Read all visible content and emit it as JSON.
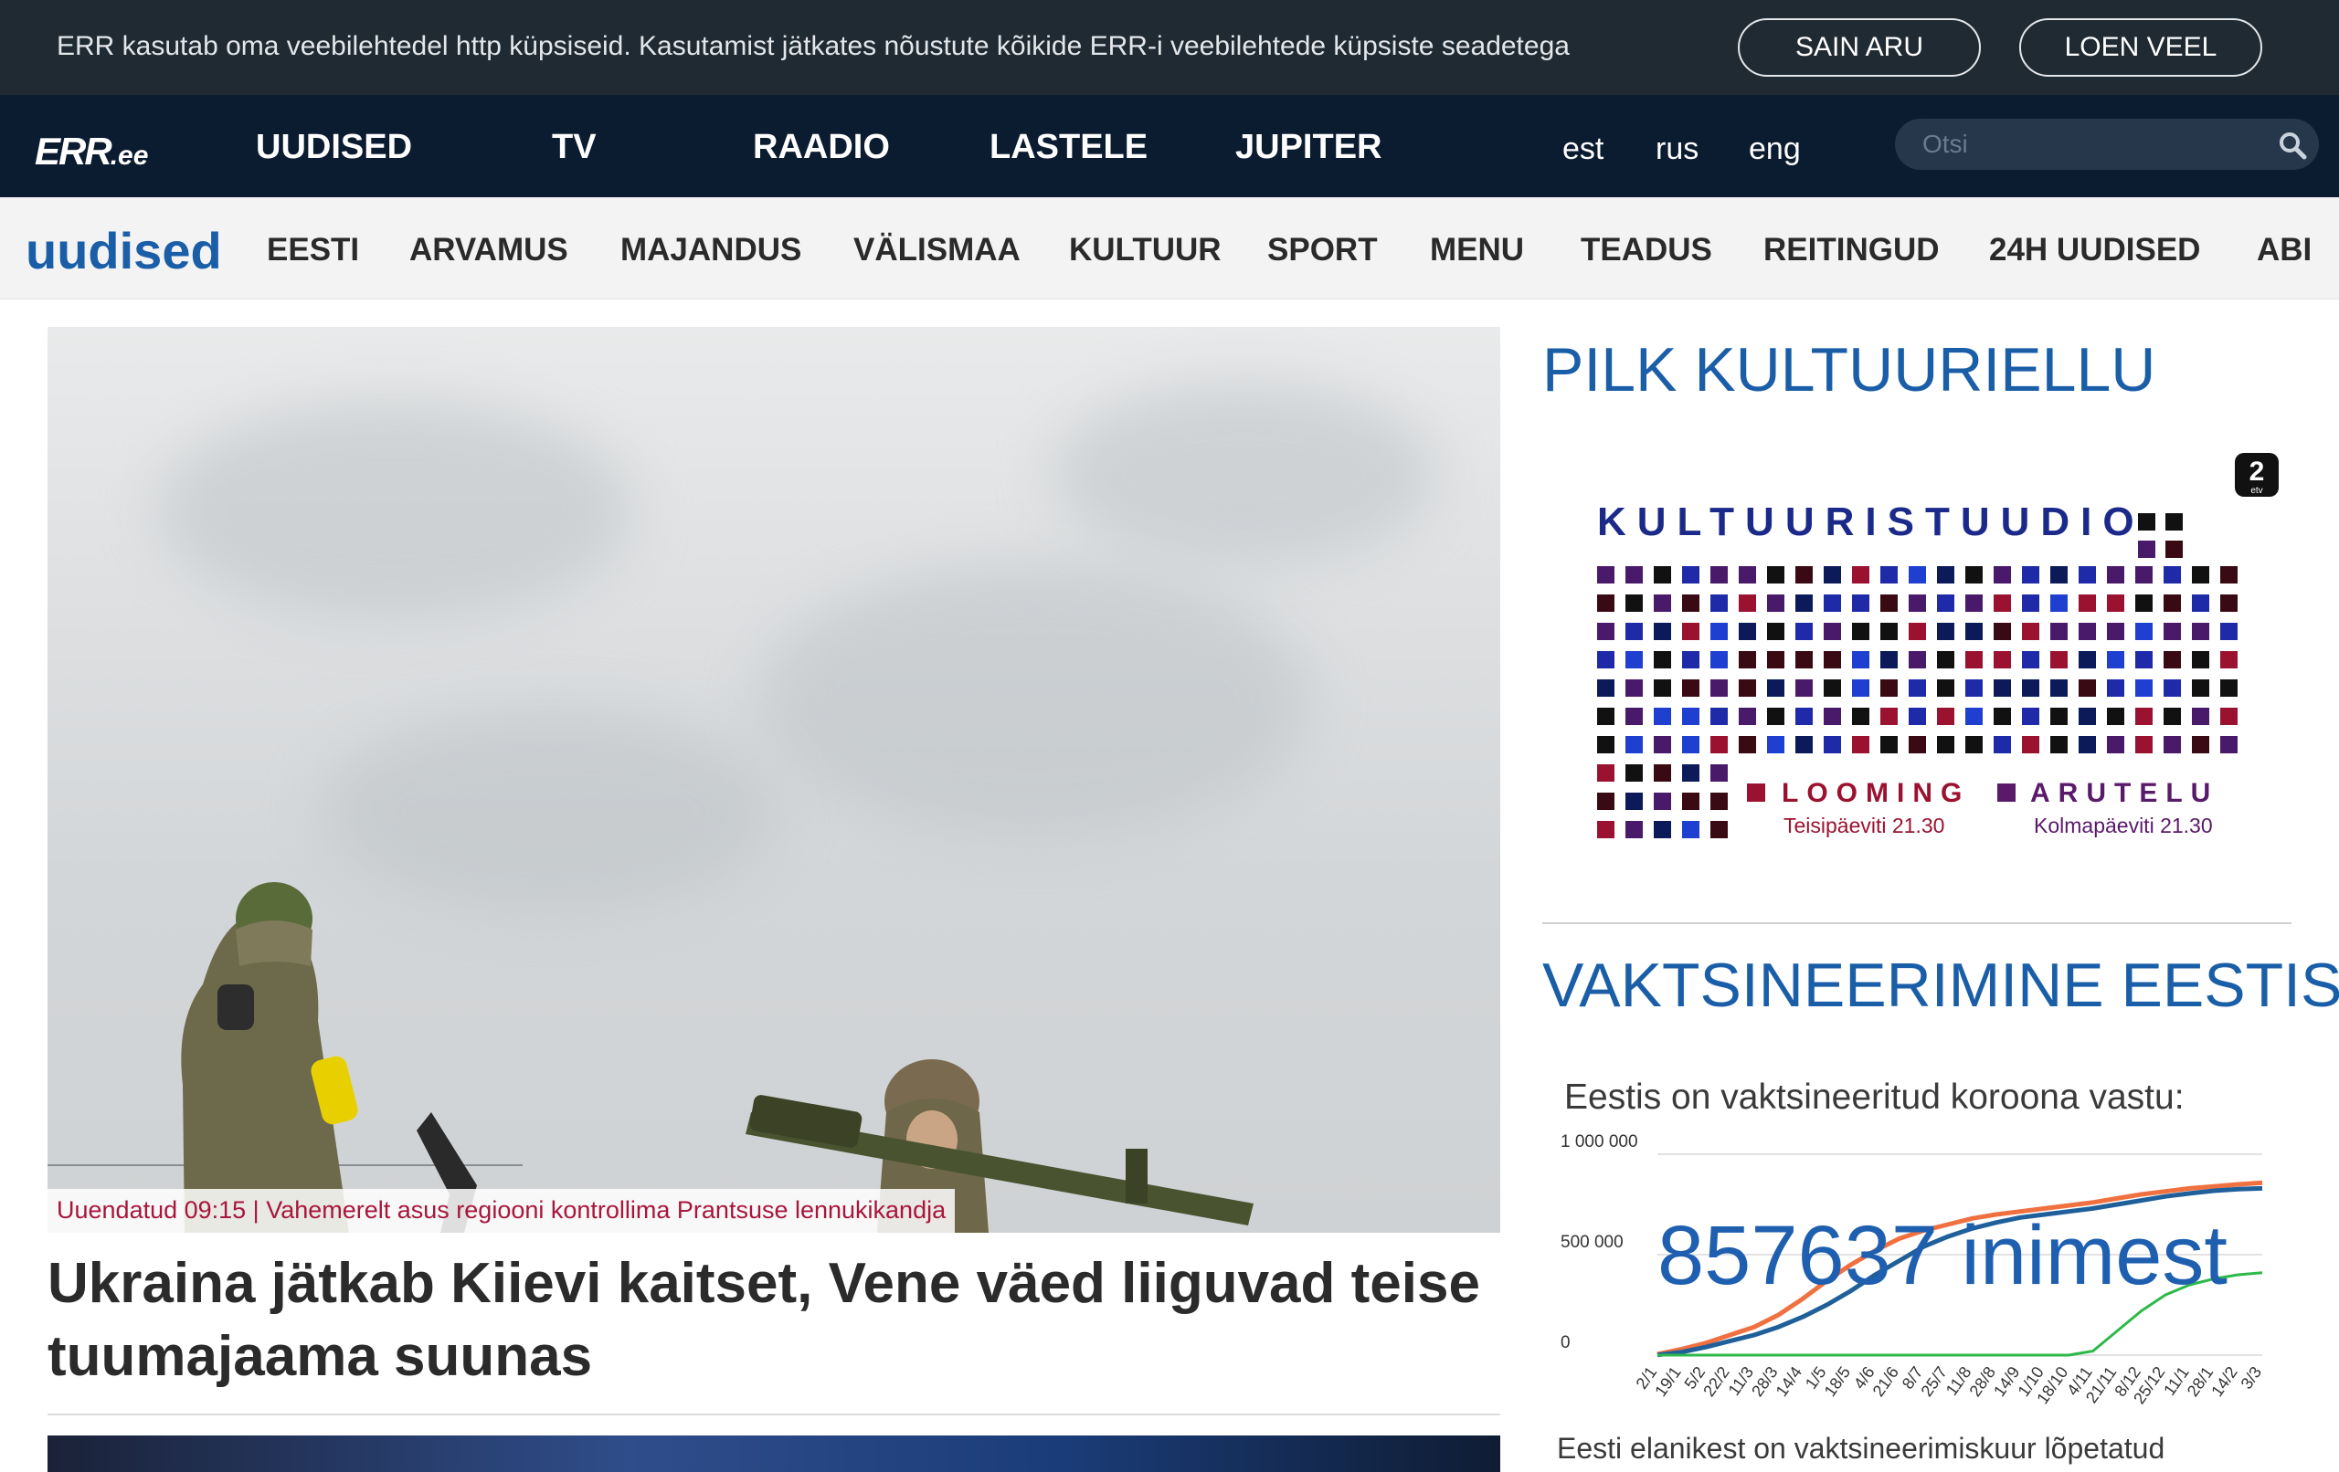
{
  "cookie": {
    "text": "ERR kasutab oma veebilehtedel http küpsiseid. Kasutamist jätkates nõustute kõikide ERR-i veebilehtede küpsiste seadetega",
    "accept_label": "SAIN ARU",
    "more_label": "LOEN VEEL"
  },
  "topnav": {
    "logo": "ERR",
    "logo_suffix": ".ee",
    "items": [
      "UUDISED",
      "TV",
      "RAADIO",
      "LASTELE",
      "JUPITER"
    ],
    "langs": [
      "est",
      "rus",
      "eng"
    ],
    "search_placeholder": "Otsi"
  },
  "subnav": {
    "brand": "uudised",
    "items": [
      "EESTI",
      "ARVAMUS",
      "MAJANDUS",
      "VÄLISMAA",
      "KULTUUR",
      "SPORT",
      "MENU",
      "TEADUS",
      "REITINGUD",
      "24H UUDISED",
      "ABI"
    ]
  },
  "hero": {
    "caption": "Uuendatud 09:15 | Vahemerelt asus regiooni kontrollima Prantsuse lennukikandja",
    "headline": "Ukraina jätkab Kiievi kaitset, Vene väed liiguvad teise tuumajaama suunas"
  },
  "promo": {
    "section_title": "PILK KULTUURIELLU",
    "title": "KULTUURISTUUDIO",
    "channel_badge": "2",
    "channel_badge_small": "etv",
    "left_show": "LOOMING",
    "left_time": "Teisipäeviti 21.30",
    "right_show": "ARUTELU",
    "right_time": "Kolmapäeviti 21.30"
  },
  "vaccination": {
    "section_title": "VAKTSINEERIMINE EESTIS",
    "label": "Eestis on vaktsineeritud koroona vastu:",
    "count": "857637 inimest",
    "footer": "Eesti elanikest on vaktsineerimiskuur lõpetatud"
  },
  "colors": {
    "cookie_bg": "#1f2a33",
    "nav_bg": "#0b1b30",
    "brand_blue": "#1a5ea8",
    "caption_red": "#a8163a",
    "series_orange": "#f07040",
    "series_blue": "#1f5f9a",
    "series_green": "#2db84a"
  },
  "chart_data": {
    "type": "line",
    "title": "",
    "y_tick_labels": [
      "1 000 000",
      "500 000",
      "0"
    ],
    "ylim": [
      0,
      1000000
    ],
    "x": [
      "2/1",
      "19/1",
      "5/2",
      "22/2",
      "11/3",
      "28/3",
      "14/4",
      "1/5",
      "18/5",
      "4/6",
      "21/6",
      "8/7",
      "25/7",
      "11/8",
      "28/8",
      "14/9",
      "1/10",
      "18/10",
      "4/11",
      "21/11",
      "8/12",
      "25/12",
      "11/1",
      "28/1",
      "14/2",
      "3/3"
    ],
    "series": [
      {
        "color": "#f07040",
        "values": [
          5000,
          30000,
          60000,
          100000,
          140000,
          200000,
          280000,
          370000,
          450000,
          520000,
          580000,
          620000,
          650000,
          680000,
          700000,
          715000,
          730000,
          745000,
          760000,
          780000,
          800000,
          815000,
          830000,
          840000,
          850000,
          857637
        ]
      },
      {
        "color": "#1f5f9a",
        "values": [
          1000,
          15000,
          40000,
          70000,
          100000,
          140000,
          190000,
          250000,
          320000,
          400000,
          470000,
          540000,
          590000,
          630000,
          660000,
          685000,
          700000,
          715000,
          730000,
          750000,
          770000,
          790000,
          805000,
          818000,
          826000,
          830000
        ]
      },
      {
        "color": "#2db84a",
        "values": [
          0,
          0,
          0,
          0,
          0,
          0,
          0,
          0,
          0,
          0,
          0,
          0,
          0,
          0,
          0,
          0,
          0,
          0,
          20000,
          120000,
          220000,
          300000,
          350000,
          380000,
          400000,
          410000
        ]
      }
    ]
  }
}
